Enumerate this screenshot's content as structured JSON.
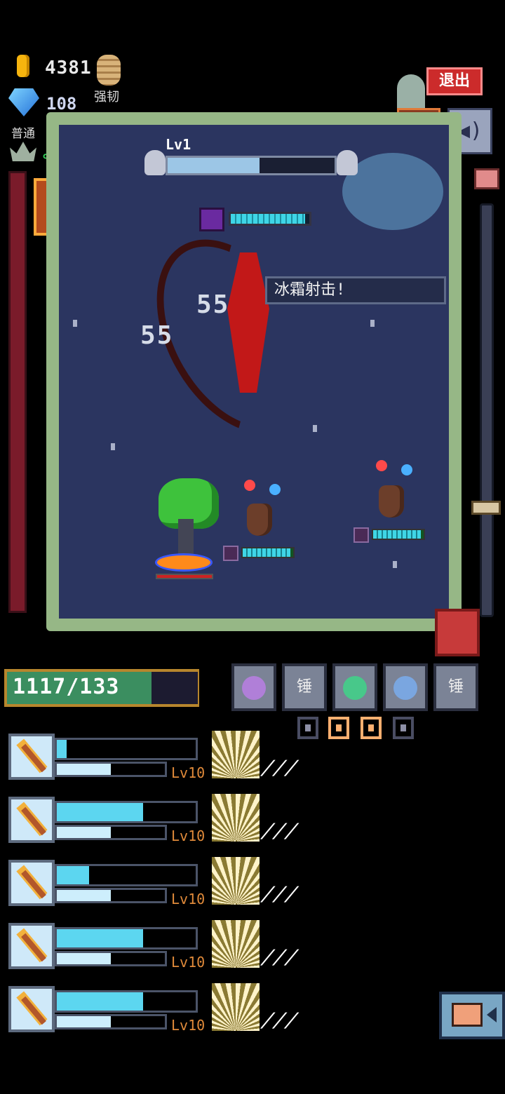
{
  "hud": {
    "gold": "4381",
    "material_label": "强韧",
    "gems": "108",
    "mode": "普通"
  },
  "buttons": {
    "exit": "退出"
  },
  "stage": {
    "level_label": "Lv1",
    "level_progress": 0.55,
    "skill_banner": "冰霜射击!",
    "damage_numbers": [
      "55",
      "55"
    ],
    "boss_hp_fraction": 0.95,
    "ally_hp_fractions": [
      0.95,
      0.95
    ]
  },
  "player": {
    "hp_text": "1117/133"
  },
  "slots": [
    {
      "type": "weapon",
      "color": "#b07fd8"
    },
    {
      "type": "text",
      "label": "锤"
    },
    {
      "type": "weapon",
      "color": "#48c88a"
    },
    {
      "type": "weapon",
      "color": "#7aa6e0"
    },
    {
      "type": "text",
      "label": "锤"
    }
  ],
  "weapons": [
    {
      "level": "Lv10",
      "charge": 0.07,
      "progress": 0.5
    },
    {
      "level": "Lv10",
      "charge": 0.62,
      "progress": 0.5
    },
    {
      "level": "Lv10",
      "charge": 0.23,
      "progress": 0.5
    },
    {
      "level": "Lv10",
      "charge": 0.62,
      "progress": 0.5
    },
    {
      "level": "Lv10",
      "charge": 0.62,
      "progress": 0.5
    }
  ]
}
